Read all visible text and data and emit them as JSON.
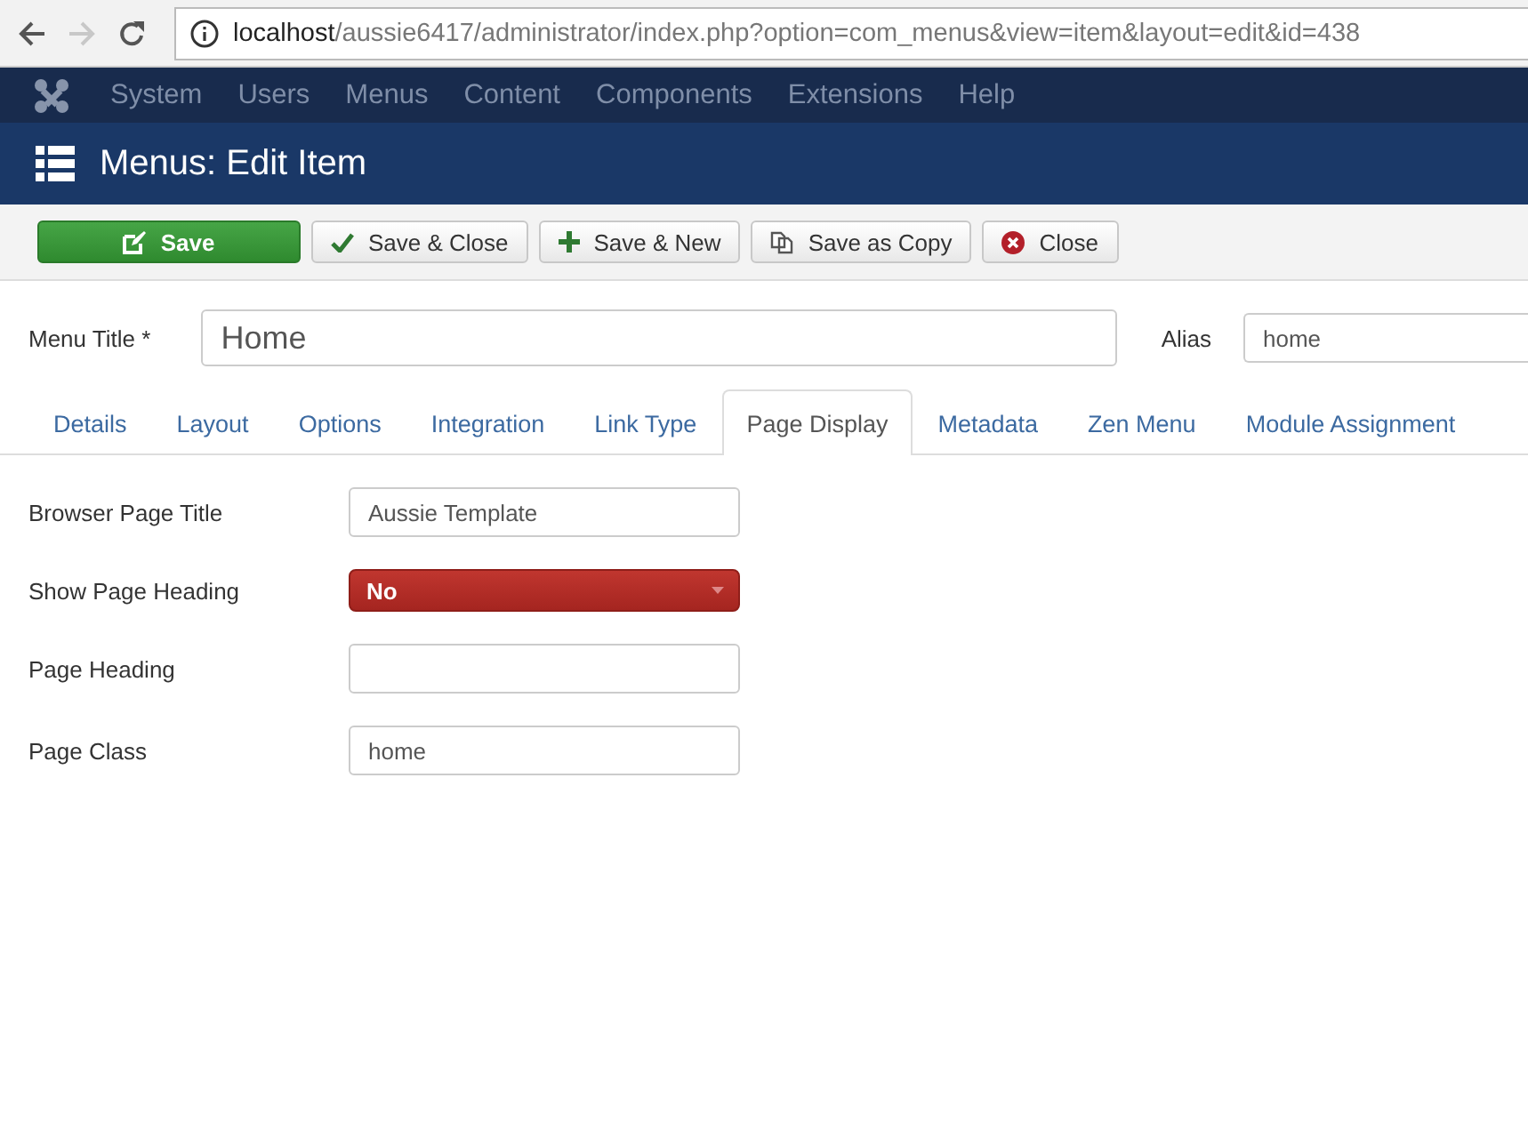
{
  "browser": {
    "back_disabled": false,
    "forward_disabled": true,
    "url_host": "localhost",
    "url_path": "/aussie6417/administrator/index.php?option=com_menus&view=item&layout=edit&id=438"
  },
  "nav": {
    "items": [
      "System",
      "Users",
      "Menus",
      "Content",
      "Components",
      "Extensions",
      "Help"
    ]
  },
  "page_title": "Menus: Edit Item",
  "toolbar": [
    {
      "label": "Save",
      "kind": "primary"
    },
    {
      "label": "Save & Close",
      "kind": "default"
    },
    {
      "label": "Save & New",
      "kind": "default"
    },
    {
      "label": "Save as Copy",
      "kind": "default"
    },
    {
      "label": "Close",
      "kind": "default"
    }
  ],
  "title_field": {
    "label": "Menu Title *",
    "value": "Home"
  },
  "alias_field": {
    "label": "Alias",
    "value": "home"
  },
  "tabs": [
    {
      "label": "Details",
      "selected": false
    },
    {
      "label": "Layout",
      "selected": false
    },
    {
      "label": "Options",
      "selected": false
    },
    {
      "label": "Integration",
      "selected": false
    },
    {
      "label": "Link Type",
      "selected": false
    },
    {
      "label": "Page Display",
      "selected": true
    },
    {
      "label": "Metadata",
      "selected": false
    },
    {
      "label": "Zen Menu",
      "selected": false
    },
    {
      "label": "Module Assignment",
      "selected": false
    }
  ],
  "fields": [
    {
      "label": "Browser Page Title",
      "kind": "text",
      "value": "Aussie Template"
    },
    {
      "label": "Show Page Heading",
      "kind": "select",
      "value": "No"
    },
    {
      "label": "Page Heading",
      "kind": "text"
    },
    {
      "label": "Page Class",
      "kind": "text",
      "value": "home"
    }
  ]
}
